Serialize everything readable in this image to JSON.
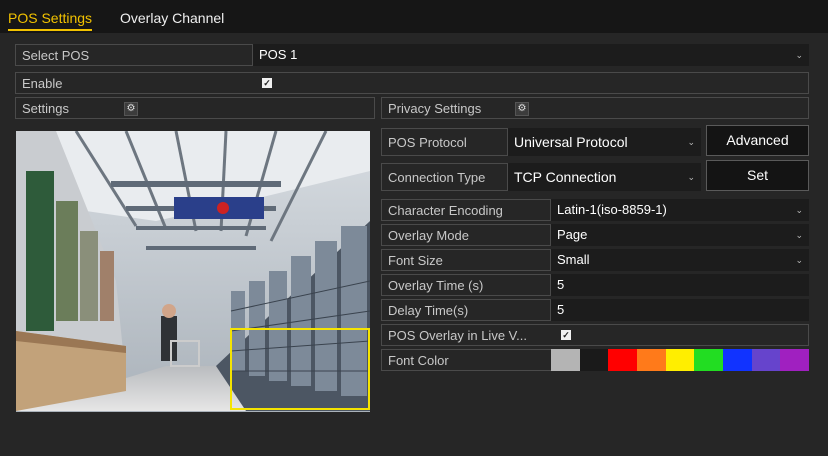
{
  "tabs": {
    "pos_settings": "POS Settings",
    "overlay_channel": "Overlay Channel"
  },
  "select_pos": {
    "label": "Select POS",
    "value": "POS 1"
  },
  "enable": {
    "label": "Enable",
    "checked": true
  },
  "settings": {
    "label": "Settings"
  },
  "privacy_settings": {
    "label": "Privacy Settings"
  },
  "pos_protocol": {
    "label": "POS Protocol",
    "value": "Universal Protocol",
    "button": "Advanced"
  },
  "connection_type": {
    "label": "Connection Type",
    "value": "TCP Connection",
    "button": "Set"
  },
  "character_encoding": {
    "label": "Character Encoding",
    "value": "Latin-1(iso-8859-1)"
  },
  "overlay_mode": {
    "label": "Overlay Mode",
    "value": "Page"
  },
  "font_size": {
    "label": "Font Size",
    "value": "Small"
  },
  "overlay_time": {
    "label": "Overlay Time (s)",
    "value": "5"
  },
  "delay_time": {
    "label": "Delay Time(s)",
    "value": "5"
  },
  "pos_overlay_live": {
    "label": "POS Overlay in Live V...",
    "checked": true
  },
  "font_color": {
    "label": "Font Color",
    "swatches": [
      "#b4b4b4",
      "#1a1a1a",
      "#ff0000",
      "#ff7a1a",
      "#ffee00",
      "#22dd22",
      "#1133ff",
      "#6644cc",
      "#a020c0"
    ]
  },
  "colors": {
    "accent": "#f2c200",
    "overlay_rect": "#f5e400"
  }
}
